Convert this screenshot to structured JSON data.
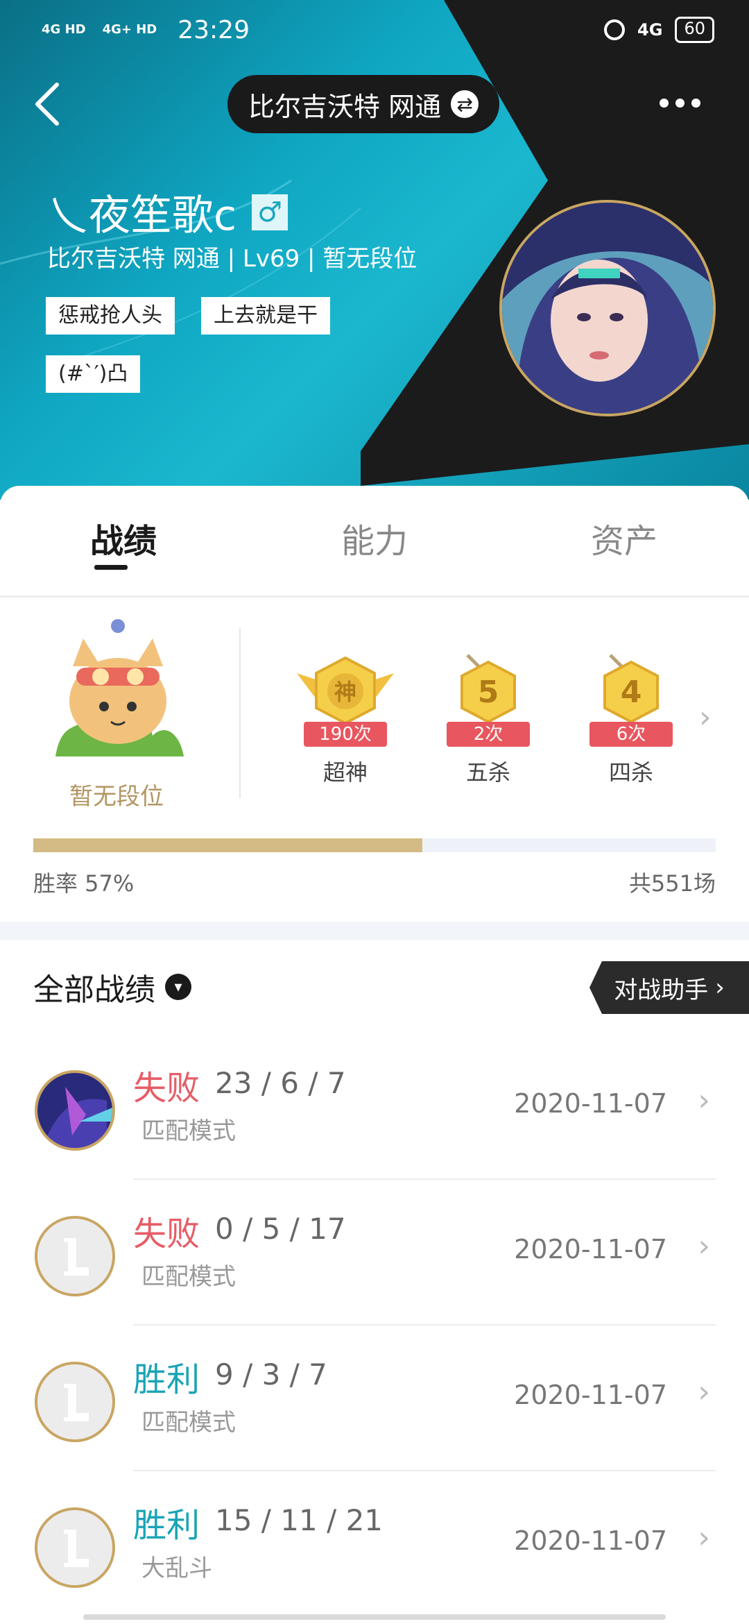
{
  "status_bar": {
    "signal1": "4G HD",
    "signal2": "4G+ HD",
    "time": "23:29",
    "network": "4G",
    "battery": "60"
  },
  "header": {
    "server": "比尔吉沃特 网通",
    "name": "乀夜笙歌c",
    "gender_symbol": "♂",
    "subtitle": "比尔吉沃特 网通 | Lv69 | 暂无段位",
    "tags": [
      "惩戒抢人头",
      "上去就是干",
      "(#`′)凸"
    ]
  },
  "tabs": [
    {
      "label": "战绩",
      "active": true
    },
    {
      "label": "能力",
      "active": false
    },
    {
      "label": "资产",
      "active": false
    }
  ],
  "stats": {
    "rank_label": "暂无段位",
    "badges": [
      {
        "glyph": "神",
        "count": "190次",
        "label": "超神"
      },
      {
        "glyph": "5",
        "count": "2次",
        "label": "五杀"
      },
      {
        "glyph": "4",
        "count": "6次",
        "label": "四杀"
      }
    ],
    "win_rate_label": "胜率  57%",
    "win_rate": 0.57,
    "total_label": "共551场"
  },
  "matches_section": {
    "title": "全部战绩",
    "assist_button": "对战助手"
  },
  "matches": [
    {
      "result": "失败",
      "kda": "23 / 6 / 7",
      "mode": "匹配模式",
      "date": "2020-11-07",
      "outcome": "lose",
      "icon": "champion-portrait"
    },
    {
      "result": "失败",
      "kda": "0 / 5 / 17",
      "mode": "匹配模式",
      "date": "2020-11-07",
      "outcome": "lose",
      "icon": "placeholder-L"
    },
    {
      "result": "胜利",
      "kda": "9 / 3 / 7",
      "mode": "匹配模式",
      "date": "2020-11-07",
      "outcome": "win",
      "icon": "placeholder-L"
    },
    {
      "result": "胜利",
      "kda": "15 / 11 / 21",
      "mode": "大乱斗",
      "date": "2020-11-07",
      "outcome": "win",
      "icon": "placeholder-L"
    }
  ],
  "colors": {
    "lose": "#e65d66",
    "win": "#1aa4b6",
    "gold": "#c9a562",
    "header_teal": "#0fa6c2"
  }
}
